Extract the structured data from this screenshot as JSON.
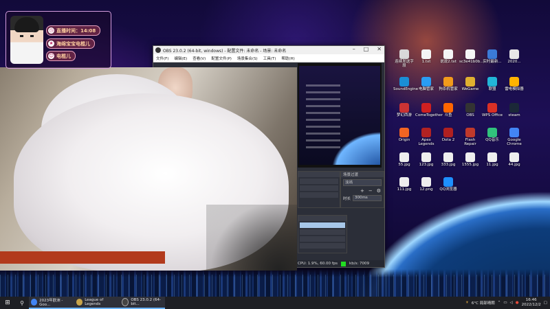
{
  "overlay": {
    "stream_time_label": "直播时间：14:08",
    "line2": "海绵宝宝电棍儿",
    "line3": "电棍儿"
  },
  "obs": {
    "title": "OBS 23.0.2 (64-bit, windows) - 配置文件: 未命名 - 场景: 未命名",
    "menu": [
      "文件(F)",
      "编辑(E)",
      "查看(V)",
      "配置文件(P)",
      "场景集合(S)",
      "工具(T)",
      "帮助(H)"
    ],
    "transition_header": "场景过渡",
    "transition_value": "淡出",
    "duration_label": "时长",
    "duration_value": "300ms",
    "status": "CPU: 1.9%, 60.00 fps",
    "kbps": "kb/s: 7009"
  },
  "desktop_icons": [
    {
      "label": "连续发送字段",
      "color": "#d9d9d9"
    },
    {
      "label": "1.txt",
      "color": "#f5f5f5"
    },
    {
      "label": "说说2.txt",
      "color": "#f5f5f5"
    },
    {
      "label": "sc3e41b0b...",
      "color": "#f5f5f5"
    },
    {
      "label": "实时最新...",
      "color": "#3b7bd8"
    },
    {
      "label": "2020...",
      "color": "#e8e8e8"
    },
    {
      "label": "SoundEngine",
      "color": "#1a8fd6"
    },
    {
      "label": "电脑管家",
      "color": "#2a9df4"
    },
    {
      "label": "狗杀机管家",
      "color": "#f29b1b"
    },
    {
      "label": "WeGame",
      "color": "#e0b030"
    },
    {
      "label": "联盟",
      "color": "#22b5d8"
    },
    {
      "label": "雷电模拟器",
      "color": "#ffb300"
    },
    {
      "label": "梦幻西游",
      "color": "#cc3333"
    },
    {
      "label": "ComeTogether",
      "color": "#d02020"
    },
    {
      "label": "斗鱼",
      "color": "#ff6600"
    },
    {
      "label": "OBS",
      "color": "#333333"
    },
    {
      "label": "WPS Office",
      "color": "#d93025"
    },
    {
      "label": "steam",
      "color": "#1b2838"
    },
    {
      "label": "Origin",
      "color": "#f26522"
    },
    {
      "label": "Apex Legends",
      "color": "#b22222"
    },
    {
      "label": "Dota 2",
      "color": "#b02020"
    },
    {
      "label": "Flash Repair",
      "color": "#c0392b"
    },
    {
      "label": "QQ音乐",
      "color": "#31c27c"
    },
    {
      "label": "Google Chrome",
      "color": "#4285f4"
    },
    {
      "label": "55.jpg",
      "color": "#eeeeee"
    },
    {
      "label": "123.jpg",
      "color": "#eeeeee"
    },
    {
      "label": "333.jpg",
      "color": "#eeeeee"
    },
    {
      "label": "1555.jpg",
      "color": "#eeeeee"
    },
    {
      "label": "11.jpg",
      "color": "#eeeeee"
    },
    {
      "label": "44.jpg",
      "color": "#eeeeee"
    },
    {
      "label": "111.jpg",
      "color": "#eeeeee"
    },
    {
      "label": "12.png",
      "color": "#eeeeee"
    },
    {
      "label": "QQ浏览器",
      "color": "#1e90ff"
    }
  ],
  "taskbar": {
    "items": [
      {
        "label": "2023年欧洲 - Goo...",
        "color": "#4285f4"
      },
      {
        "label": "League of Legends",
        "color": "#c8a44a"
      },
      {
        "label": "OBS 23.0.2 (64-bit...",
        "color": "#444444"
      }
    ],
    "weather": "6°C 局部晴朗",
    "time": "16:46",
    "date": "2022/12/2"
  }
}
